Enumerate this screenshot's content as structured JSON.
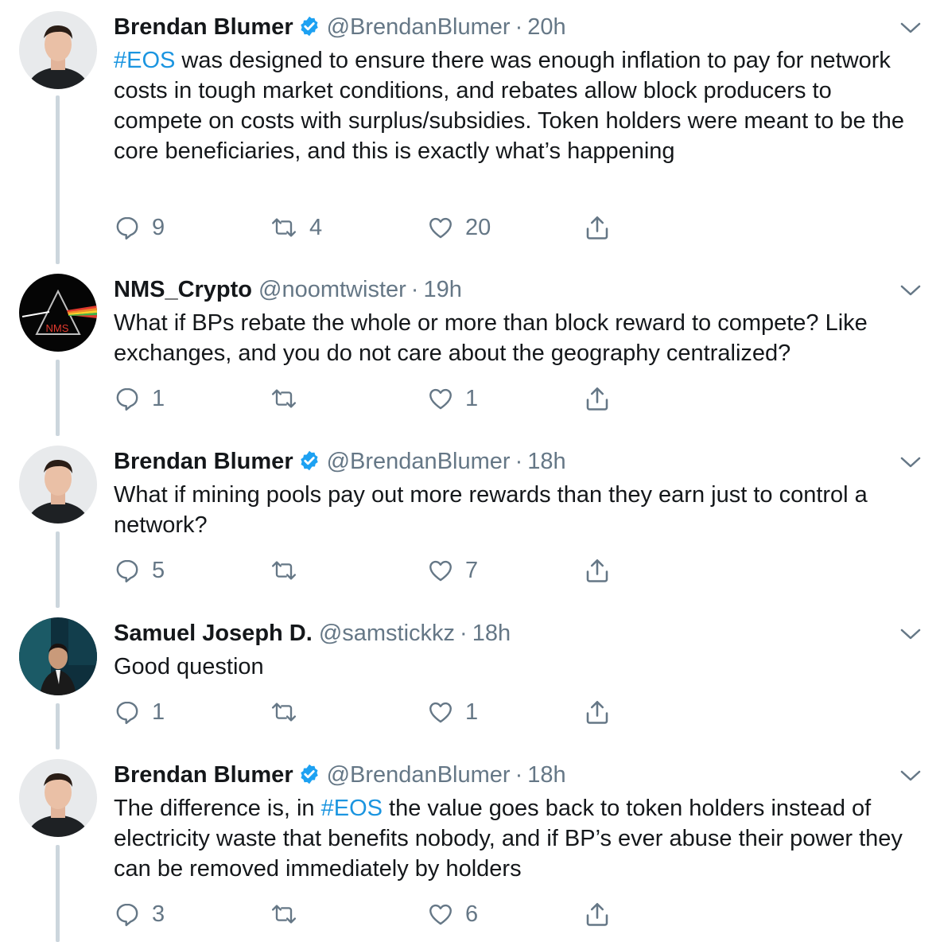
{
  "tweets": [
    {
      "name": "Brendan Blumer",
      "verified": true,
      "handle": "@BrendanBlumer",
      "time": "20h",
      "text_parts": [
        "#EOS",
        " was designed to ensure there was enough inflation to pay for network costs in tough market conditions, and rebates allow block producers to compete on costs with surplus/subsidies. Token holders were meant to be the core beneficiaries, and this is exactly what’s happening"
      ],
      "replies": "9",
      "retweets": "4",
      "likes": "20"
    },
    {
      "name": "NMS_Crypto",
      "verified": false,
      "handle": "@noomtwister",
      "time": "19h",
      "avatar_text": "NMS",
      "text_parts": [
        "What if BPs rebate the whole or more than block reward to compete? Like exchanges, and you do not care about the geography centralized?"
      ],
      "replies": "1",
      "retweets": "",
      "likes": "1"
    },
    {
      "name": "Brendan Blumer",
      "verified": true,
      "handle": "@BrendanBlumer",
      "time": "18h",
      "text_parts": [
        "What if mining pools pay out more rewards than they earn just to control a network?"
      ],
      "replies": "5",
      "retweets": "",
      "likes": "7"
    },
    {
      "name": "Samuel Joseph D.",
      "verified": false,
      "handle": "@samstickkz",
      "time": "18h",
      "text_parts": [
        "Good question"
      ],
      "replies": "1",
      "retweets": "",
      "likes": "1"
    },
    {
      "name": "Brendan Blumer",
      "verified": true,
      "handle": "@BrendanBlumer",
      "time": "18h",
      "text_parts": [
        "The difference is, in ",
        "#EOS",
        " the value goes back to token holders instead of electricity waste that benefits nobody, and if BP’s ever abuse their power they can be removed immediately by holders"
      ],
      "replies": "3",
      "retweets": "",
      "likes": "6"
    }
  ],
  "separator": "·",
  "colors": {
    "hashtag": "#1b95e0",
    "secondary_text": "#657786",
    "thread_line": "#ccd6dd",
    "verified_badge": "#1da1f2"
  },
  "icons": [
    "reply-icon",
    "retweet-icon",
    "like-icon",
    "share-icon",
    "chevron-down-icon",
    "verified-badge-icon"
  ]
}
